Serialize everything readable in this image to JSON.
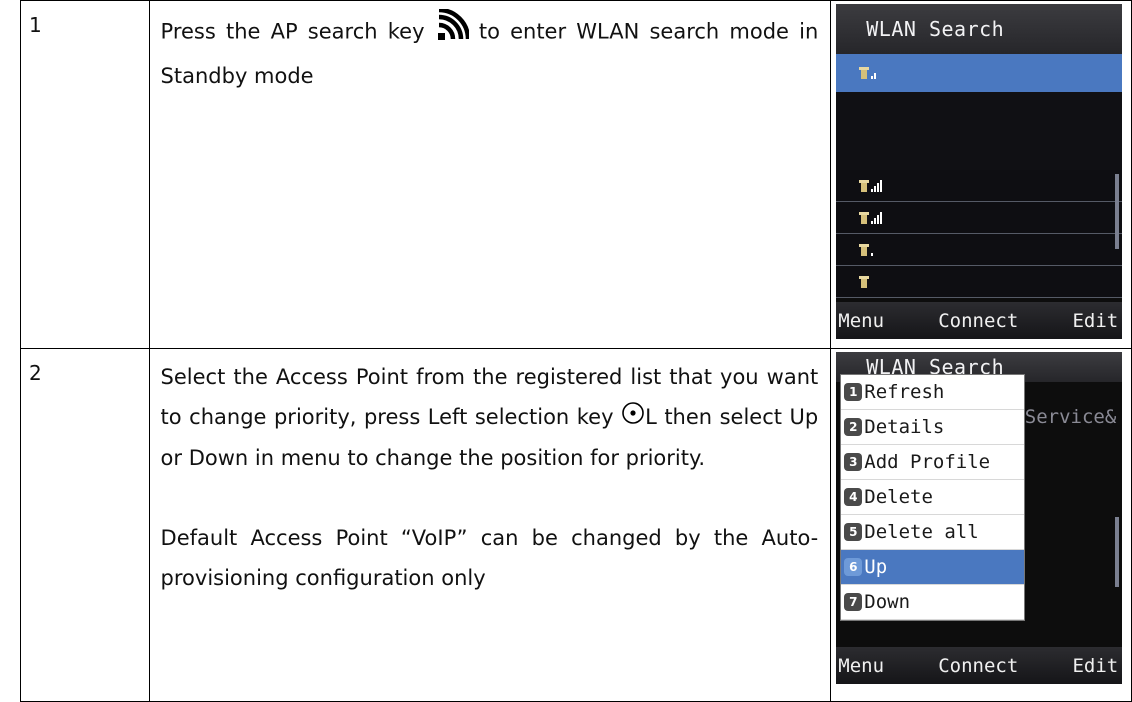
{
  "rows": [
    {
      "num": "1",
      "desc_before_icon": "Press the AP search key",
      "icon": "wifi-signal-icon",
      "desc_after_icon": "to enter WLAN search mode in Standby mode",
      "screen": {
        "title": "WLAN Search",
        "softkeys": [
          "Menu",
          "Connect",
          "Edit"
        ]
      }
    },
    {
      "num": "2",
      "desc_before_icon": "Select the Access Point from the registered list that you want to change priority, press Left selection key",
      "icon": "left-selection-key-icon",
      "icon_suffix": "L",
      "desc_after_icon": "then select Up or Down in menu to change the position for priority.",
      "desc_note": "Default Access Point “VoIP” can be changed by the Auto-provisioning configuration only",
      "screen": {
        "title": "WLAN Search",
        "bg_text": "Service&",
        "menu": [
          {
            "num": "1",
            "label": "Refresh"
          },
          {
            "num": "2",
            "label": "Details"
          },
          {
            "num": "3",
            "label": "Add Profile"
          },
          {
            "num": "4",
            "label": "Delete"
          },
          {
            "num": "5",
            "label": "Delete all"
          },
          {
            "num": "6",
            "label": "Up",
            "selected": true
          },
          {
            "num": "7",
            "label": "Down"
          }
        ],
        "softkeys": [
          "Menu",
          "Connect",
          "Edit"
        ]
      }
    }
  ]
}
